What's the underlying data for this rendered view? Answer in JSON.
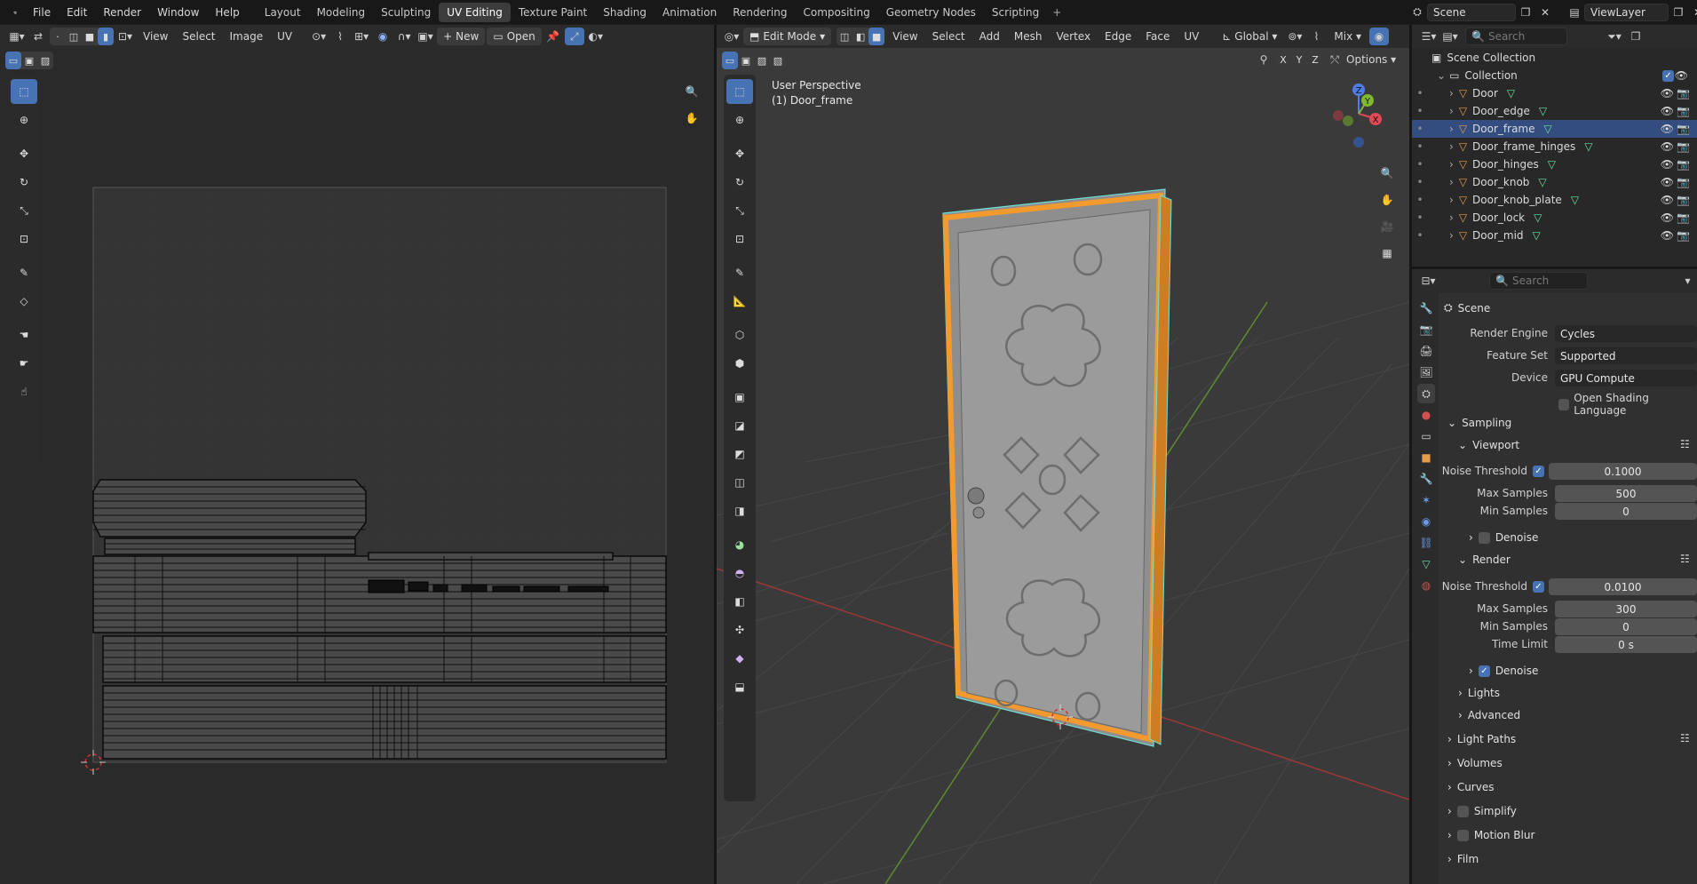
{
  "topbar": {
    "menus": [
      "File",
      "Edit",
      "Render",
      "Window",
      "Help"
    ],
    "workspaces": [
      "Layout",
      "Modeling",
      "Sculpting",
      "UV Editing",
      "Texture Paint",
      "Shading",
      "Animation",
      "Rendering",
      "Compositing",
      "Geometry Nodes",
      "Scripting"
    ],
    "active_workspace": "UV Editing",
    "plus": "+",
    "scene": "Scene",
    "viewlayer": "ViewLayer"
  },
  "uv_editor": {
    "menus": [
      "View",
      "Select",
      "Image",
      "UV"
    ],
    "new_label": "New",
    "open_label": "Open"
  },
  "viewport": {
    "mode": "Edit Mode",
    "menus": [
      "View",
      "Select",
      "Add",
      "Mesh",
      "Vertex",
      "Edge",
      "Face",
      "UV"
    ],
    "orientation": "Global",
    "snap_mode": "Mix",
    "options_label": "Options",
    "axis_toggles": [
      "X",
      "Y",
      "Z"
    ],
    "overlay_title": "User Perspective",
    "overlay_object": "(1) Door_frame",
    "gizmo_axes": [
      "X",
      "Y",
      "Z"
    ]
  },
  "outliner": {
    "search_placeholder": "Search",
    "scene_collection": "Scene Collection",
    "collection": "Collection",
    "objects": [
      "Door",
      "Door_edge",
      "Door_frame",
      "Door_frame_hinges",
      "Door_hinges",
      "Door_knob",
      "Door_knob_plate",
      "Door_lock",
      "Door_mid"
    ],
    "selected_object": "Door_frame"
  },
  "properties": {
    "search_placeholder": "Search",
    "context": "Scene",
    "render_engine_label": "Render Engine",
    "render_engine": "Cycles",
    "feature_set_label": "Feature Set",
    "feature_set": "Supported",
    "device_label": "Device",
    "device": "GPU Compute",
    "osl_label": "Open Shading Language",
    "sampling": "Sampling",
    "viewport": {
      "label": "Viewport",
      "noise_threshold_label": "Noise Threshold",
      "noise_threshold": "0.1000",
      "max_samples_label": "Max Samples",
      "max_samples": "500",
      "min_samples_label": "Min Samples",
      "min_samples": "0",
      "denoise_label": "Denoise"
    },
    "render": {
      "label": "Render",
      "noise_threshold_label": "Noise Threshold",
      "noise_threshold": "0.0100",
      "max_samples_label": "Max Samples",
      "max_samples": "300",
      "min_samples_label": "Min Samples",
      "min_samples": "0",
      "time_limit_label": "Time Limit",
      "time_limit": "0 s",
      "denoise_label": "Denoise"
    },
    "lights": "Lights",
    "advanced": "Advanced",
    "panels": [
      "Light Paths",
      "Volumes",
      "Curves",
      "Simplify",
      "Motion Blur",
      "Film"
    ]
  },
  "colors": {
    "accent": "#4772b3",
    "selected_edge": "#f29a2e",
    "active_outline": "#6ee0d6",
    "object_icon": "#e59d4b"
  }
}
